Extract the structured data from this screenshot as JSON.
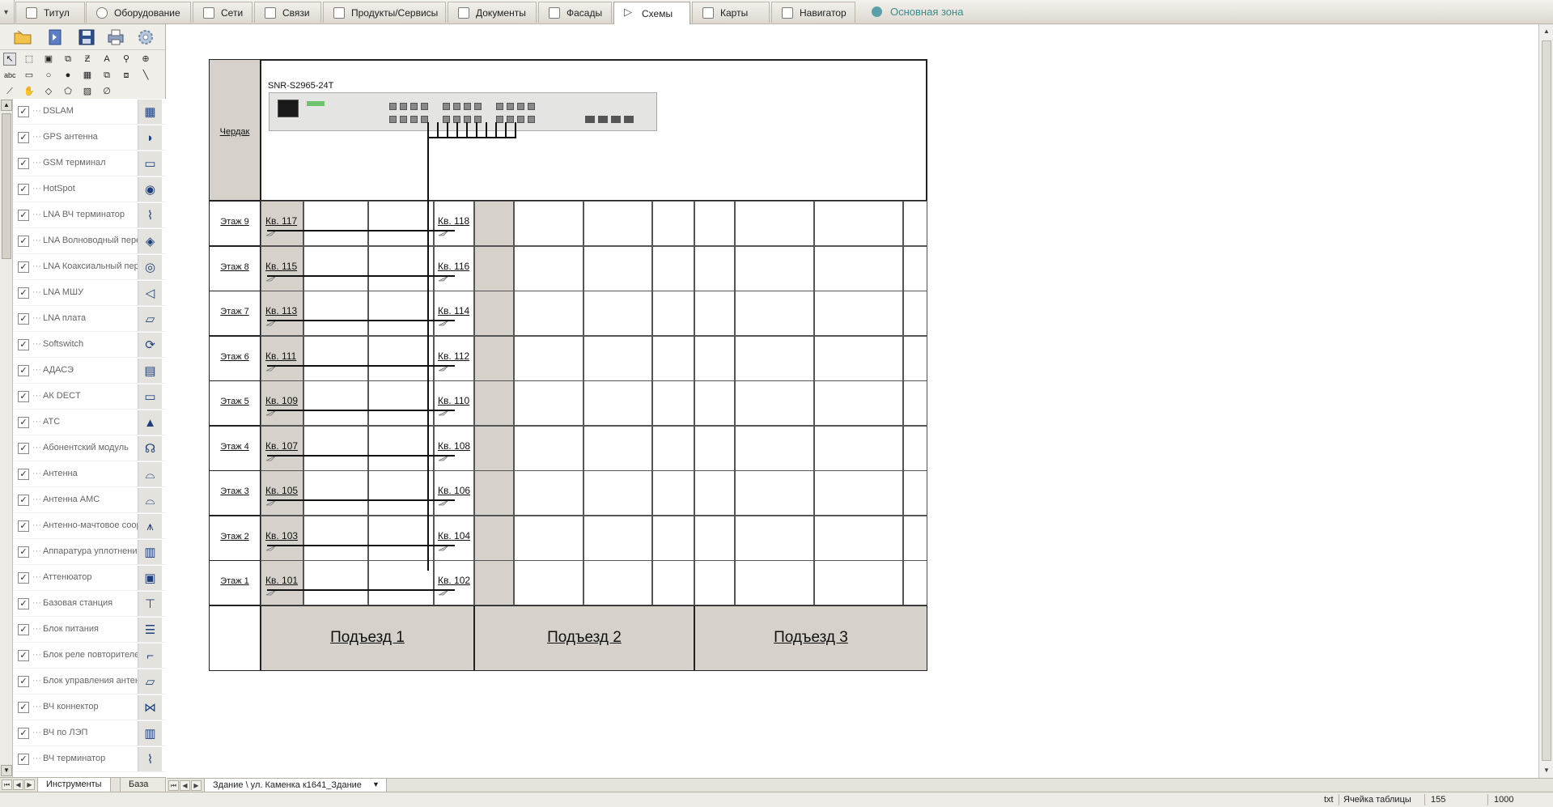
{
  "tabs": [
    {
      "label": "Титул",
      "icon": "page-icon"
    },
    {
      "label": "Оборудование",
      "icon": "database-icon"
    },
    {
      "label": "Сети",
      "icon": "network-icon"
    },
    {
      "label": "Связи",
      "icon": "links-icon"
    },
    {
      "label": "Продукты/Сервисы",
      "icon": "products-icon"
    },
    {
      "label": "Документы",
      "icon": "documents-icon"
    },
    {
      "label": "Фасады",
      "icon": "facade-icon"
    },
    {
      "label": "Схемы",
      "icon": "schemes-icon"
    },
    {
      "label": "Карты",
      "icon": "maps-icon"
    },
    {
      "label": "Навигатор",
      "icon": "navigator-icon"
    }
  ],
  "active_tab": "Схемы",
  "zone_label": "Основная зона",
  "items": [
    {
      "label": "DSLAM",
      "icon": "dslam-icon",
      "glyph": "▦"
    },
    {
      "label": "GPS антенна",
      "icon": "gps-antenna-icon",
      "glyph": "◗"
    },
    {
      "label": "GSM терминал",
      "icon": "gsm-terminal-icon",
      "glyph": "▭"
    },
    {
      "label": "HotSpot",
      "icon": "hotspot-icon",
      "glyph": "◉"
    },
    {
      "label": "LNA ВЧ терминатор",
      "icon": "terminator-icon",
      "glyph": "⌇"
    },
    {
      "label": "LNA Волноводный переход",
      "icon": "waveguide-icon",
      "glyph": "◈"
    },
    {
      "label": "LNA Коаксиальный переход",
      "icon": "coaxial-icon",
      "glyph": "◎"
    },
    {
      "label": "LNA МШУ",
      "icon": "amplifier-icon",
      "glyph": "◁"
    },
    {
      "label": "LNA плата",
      "icon": "board-icon",
      "glyph": "▱"
    },
    {
      "label": "Softswitch",
      "icon": "softswitch-icon",
      "glyph": "⟳"
    },
    {
      "label": "АДАСЭ",
      "icon": "adase-icon",
      "glyph": "▤"
    },
    {
      "label": "АК DECT",
      "icon": "dect-icon",
      "glyph": "▭"
    },
    {
      "label": "АТС",
      "icon": "ats-icon",
      "glyph": "▲"
    },
    {
      "label": "Абонентский модуль",
      "icon": "subscriber-module-icon",
      "glyph": "☊"
    },
    {
      "label": "Антенна",
      "icon": "antenna-icon",
      "glyph": "⌓"
    },
    {
      "label": "Антенна АМС",
      "icon": "antenna-ams-icon",
      "glyph": "⌓"
    },
    {
      "label": "Антенно-мачтовое сооружение",
      "icon": "mast-icon",
      "glyph": "⩚"
    },
    {
      "label": "Аппаратура уплотнения",
      "icon": "multiplexer-icon",
      "glyph": "▥"
    },
    {
      "label": "Аттенюатор",
      "icon": "attenuator-icon",
      "glyph": "▣"
    },
    {
      "label": "Базовая станция",
      "icon": "base-station-icon",
      "glyph": "⊤"
    },
    {
      "label": "Блок питания",
      "icon": "power-unit-icon",
      "glyph": "☰"
    },
    {
      "label": "Блок реле повторителей",
      "icon": "relay-icon",
      "glyph": "⌐"
    },
    {
      "label": "Блок управления антенной",
      "icon": "antenna-control-icon",
      "glyph": "▱"
    },
    {
      "label": "ВЧ коннектор",
      "icon": "connector-icon",
      "glyph": "⋈"
    },
    {
      "label": "ВЧ по ЛЭП",
      "icon": "powerline-icon",
      "glyph": "▥"
    },
    {
      "label": "ВЧ терминатор",
      "icon": "hf-terminator-icon",
      "glyph": "⌇"
    }
  ],
  "left_tabs": [
    "Инструменты",
    "База данн"
  ],
  "sheet_tab": "Здание \\ ул. Каменка к1641_Здание",
  "diagram": {
    "switch_name": "SNR-S2965-24T",
    "attic_label": "Чердак",
    "floors": [
      {
        "label": "Этаж 9",
        "apt1": "Кв. 117",
        "apt2": "Кв. 118"
      },
      {
        "label": "Этаж 8",
        "apt1": "Кв. 115",
        "apt2": "Кв. 116"
      },
      {
        "label": "Этаж 7",
        "apt1": "Кв. 113",
        "apt2": "Кв. 114"
      },
      {
        "label": "Этаж 6",
        "apt1": "Кв. 111",
        "apt2": "Кв. 112"
      },
      {
        "label": "Этаж 5",
        "apt1": "Кв. 109",
        "apt2": "Кв. 110"
      },
      {
        "label": "Этаж 4",
        "apt1": "Кв. 107",
        "apt2": "Кв. 108"
      },
      {
        "label": "Этаж 3",
        "apt1": "Кв. 105",
        "apt2": "Кв. 106"
      },
      {
        "label": "Этаж 2",
        "apt1": "Кв. 103",
        "apt2": "Кв. 104"
      },
      {
        "label": "Этаж 1",
        "apt1": "Кв. 101",
        "apt2": "Кв. 102"
      }
    ],
    "entrances": [
      "Подъезд 1",
      "Подъезд 2",
      "Подъезд 3"
    ]
  },
  "status": {
    "type": "txt",
    "object": "Ячейка таблицы",
    "value1": "155",
    "value2": "1000"
  }
}
